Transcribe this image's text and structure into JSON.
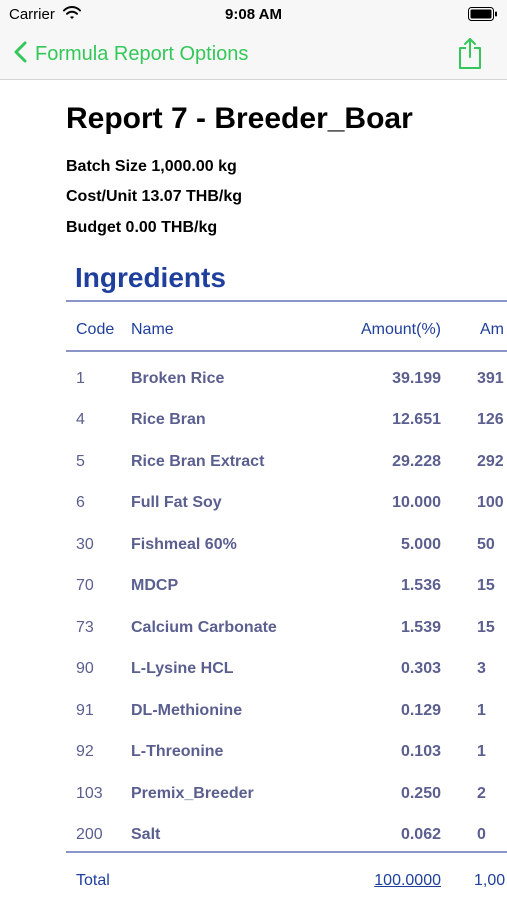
{
  "status_bar": {
    "carrier": "Carrier",
    "time": "9:08 AM"
  },
  "nav": {
    "back_label": "Formula Report Options"
  },
  "report": {
    "title": "Report 7 - Breeder_Boar",
    "batch_size": "Batch Size 1,000.00 kg",
    "cost_unit": "Cost/Unit 13.07 THB/kg",
    "budget": "Budget 0.00 THB/kg"
  },
  "ingredients": {
    "section_title": "Ingredients",
    "headers": {
      "code": "Code",
      "name": "Name",
      "amount_pct": "Amount(%)",
      "amount_2": "Am"
    },
    "rows": [
      {
        "code": "1",
        "name": "Broken Rice",
        "amount_pct": "39.199",
        "amount_2": "391"
      },
      {
        "code": "4",
        "name": "Rice Bran",
        "amount_pct": "12.651",
        "amount_2": "126"
      },
      {
        "code": "5",
        "name": "Rice Bran Extract",
        "amount_pct": "29.228",
        "amount_2": "292"
      },
      {
        "code": "6",
        "name": "Full Fat Soy",
        "amount_pct": "10.000",
        "amount_2": "100"
      },
      {
        "code": "30",
        "name": "Fishmeal 60%",
        "amount_pct": "5.000",
        "amount_2": "50"
      },
      {
        "code": "70",
        "name": "MDCP",
        "amount_pct": "1.536",
        "amount_2": "15"
      },
      {
        "code": "73",
        "name": "Calcium Carbonate",
        "amount_pct": "1.539",
        "amount_2": "15"
      },
      {
        "code": "90",
        "name": "L-Lysine HCL",
        "amount_pct": "0.303",
        "amount_2": "3"
      },
      {
        "code": "91",
        "name": "DL-Methionine",
        "amount_pct": "0.129",
        "amount_2": "1"
      },
      {
        "code": "92",
        "name": "L-Threonine",
        "amount_pct": "0.103",
        "amount_2": "1"
      },
      {
        "code": "103",
        "name": "Premix_Breeder",
        "amount_pct": "0.250",
        "amount_2": "2"
      },
      {
        "code": "200",
        "name": "Salt",
        "amount_pct": "0.062",
        "amount_2": "0"
      }
    ],
    "total": {
      "label": "Total",
      "amount_pct": "100.0000",
      "amount_2": "1,00"
    }
  },
  "colors": {
    "accent": "#34c759",
    "heading": "#1f3f9d",
    "row_text": "#5b5f8f",
    "rule": "#8b95c9"
  },
  "icons": {
    "back": "chevron-left-icon",
    "share": "share-icon",
    "wifi": "wifi-icon",
    "battery": "battery-icon"
  }
}
